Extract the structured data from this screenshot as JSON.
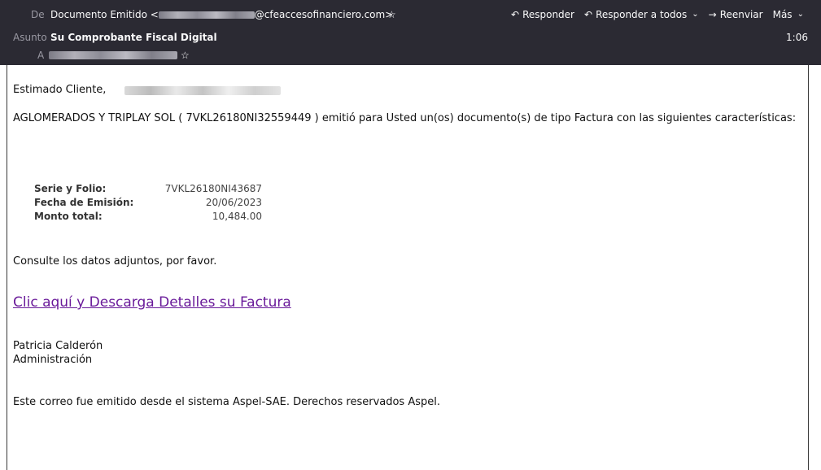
{
  "header": {
    "from_label": "De",
    "from_name": "Documento Emitido <",
    "from_domain": "@cfeaccesofinanciero.com>",
    "subject_label": "Asunto",
    "subject": "Su Comprobante Fiscal Digital",
    "time": "1:06",
    "to_label": "A",
    "actions": {
      "reply": "Responder",
      "reply_all": "Responder a todos",
      "forward": "Reenviar",
      "more": "Más"
    }
  },
  "body": {
    "greeting": "Estimado Cliente,",
    "intro": "AGLOMERADOS Y TRIPLAY SOL   ( 7VKL26180NI32559449 ) emitió para Usted un(os) documento(s) de tipo Factura con las siguientes características:",
    "details": [
      {
        "key": "Serie y Folio:",
        "value": "7VKL26180NI43687"
      },
      {
        "key": "Fecha de Emisión:",
        "value": "20/06/2023"
      },
      {
        "key": "Monto total:",
        "value": "10,484.00"
      }
    ],
    "consult": "Consulte los datos adjuntos, por favor.",
    "link": "Clic aquí y Descarga Detalles su Factura",
    "signature_name": "Patricia Calderón",
    "signature_dept": "Administración",
    "footer": "Este correo fue emitido desde el sistema Aspel-SAE. Derechos reservados Aspel."
  },
  "colors": {
    "header_bg": "#2b2a33",
    "link": "#6a1b9a"
  }
}
